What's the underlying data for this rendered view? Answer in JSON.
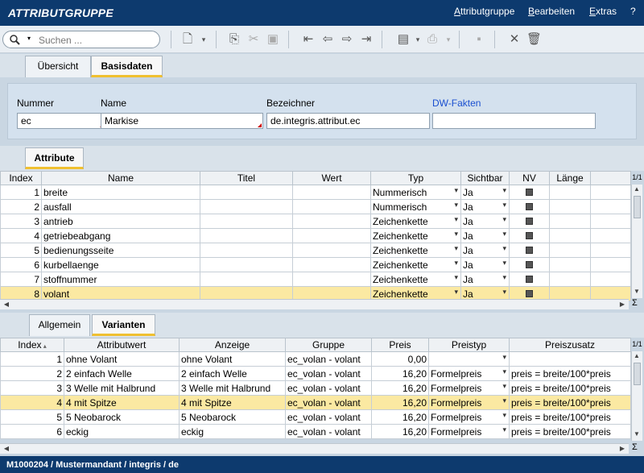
{
  "app": {
    "title": "ATTRIBUTGRUPPE"
  },
  "menu": {
    "items": [
      {
        "first": "A",
        "rest": "ttributgruppe"
      },
      {
        "first": "B",
        "rest": "earbeiten"
      },
      {
        "first": "E",
        "rest": "xtras"
      },
      {
        "first": "",
        "rest": "?"
      }
    ]
  },
  "search": {
    "placeholder": "Suchen ..."
  },
  "tabs_top": [
    "Übersicht",
    "Basisdaten"
  ],
  "form": {
    "nummer_label": "Nummer",
    "nummer_value": "ec",
    "name_label": "Name",
    "name_value": "Markise",
    "bezeichner_label": "Bezeichner",
    "bezeichner_value": "de.integris.attribut.ec",
    "dwfakten_label": "DW-Fakten",
    "dwfakten_value": ""
  },
  "tab_attribute": "Attribute",
  "attr_table": {
    "page": "1/1",
    "headers": [
      "Index",
      "Name",
      "Titel",
      "Wert",
      "Typ",
      "Sichtbar",
      "NV",
      "Länge"
    ],
    "rows": [
      {
        "index": "1",
        "name": "breite",
        "titel": "",
        "wert": "",
        "typ": "Nummerisch",
        "sichtbar": "Ja"
      },
      {
        "index": "2",
        "name": "ausfall",
        "titel": "",
        "wert": "",
        "typ": "Nummerisch",
        "sichtbar": "Ja"
      },
      {
        "index": "3",
        "name": "antrieb",
        "titel": "",
        "wert": "",
        "typ": "Zeichenkette",
        "sichtbar": "Ja"
      },
      {
        "index": "4",
        "name": "getriebeabgang",
        "titel": "",
        "wert": "",
        "typ": "Zeichenkette",
        "sichtbar": "Ja"
      },
      {
        "index": "5",
        "name": "bedienungsseite",
        "titel": "",
        "wert": "",
        "typ": "Zeichenkette",
        "sichtbar": "Ja"
      },
      {
        "index": "6",
        "name": "kurbellaenge",
        "titel": "",
        "wert": "",
        "typ": "Zeichenkette",
        "sichtbar": "Ja"
      },
      {
        "index": "7",
        "name": "stoffnummer",
        "titel": "",
        "wert": "",
        "typ": "Zeichenkette",
        "sichtbar": "Ja"
      },
      {
        "index": "8",
        "name": "volant",
        "titel": "",
        "wert": "",
        "typ": "Zeichenkette",
        "sichtbar": "Ja"
      }
    ],
    "sigma": "Σ"
  },
  "tabs_bottom": [
    "Allgemein",
    "Varianten"
  ],
  "var_table": {
    "page": "1/1",
    "headers": [
      "Index",
      "Attributwert",
      "Anzeige",
      "Gruppe",
      "Preis",
      "Preistyp",
      "Preiszusatz"
    ],
    "rows": [
      {
        "index": "1",
        "attributwert": "ohne Volant",
        "anzeige": "ohne Volant",
        "gruppe": "ec_volan - volant",
        "preis": "0,00",
        "preistyp": "",
        "preiszusatz": ""
      },
      {
        "index": "2",
        "attributwert": "2 einfach Welle",
        "anzeige": "2 einfach Welle",
        "gruppe": "ec_volan - volant",
        "preis": "16,20",
        "preistyp": "Formelpreis",
        "preiszusatz": "preis = breite/100*preis"
      },
      {
        "index": "3",
        "attributwert": "3 Welle mit Halbrund",
        "anzeige": "3 Welle mit Halbrund",
        "gruppe": "ec_volan - volant",
        "preis": "16,20",
        "preistyp": "Formelpreis",
        "preiszusatz": "preis = breite/100*preis"
      },
      {
        "index": "4",
        "attributwert": "4 mit Spitze",
        "anzeige": "4 mit Spitze",
        "gruppe": "ec_volan - volant",
        "preis": "16,20",
        "preistyp": "Formelpreis",
        "preiszusatz": "preis = breite/100*preis"
      },
      {
        "index": "5",
        "attributwert": "5 Neobarock",
        "anzeige": "5 Neobarock",
        "gruppe": "ec_volan - volant",
        "preis": "16,20",
        "preistyp": "Formelpreis",
        "preiszusatz": "preis = breite/100*preis"
      },
      {
        "index": "6",
        "attributwert": "eckig",
        "anzeige": "eckig",
        "gruppe": "ec_volan - volant",
        "preis": "16,20",
        "preistyp": "Formelpreis",
        "preiszusatz": "preis = breite/100*preis"
      }
    ],
    "sigma": "Σ"
  },
  "status": {
    "text": "M1000204 / Mustermandant / integris / de"
  },
  "colors": {
    "titlebar": "#0d3a6e",
    "selected_row": "#fbe9a2",
    "tab_accent": "#f0c030",
    "link": "#1a4fd0"
  }
}
